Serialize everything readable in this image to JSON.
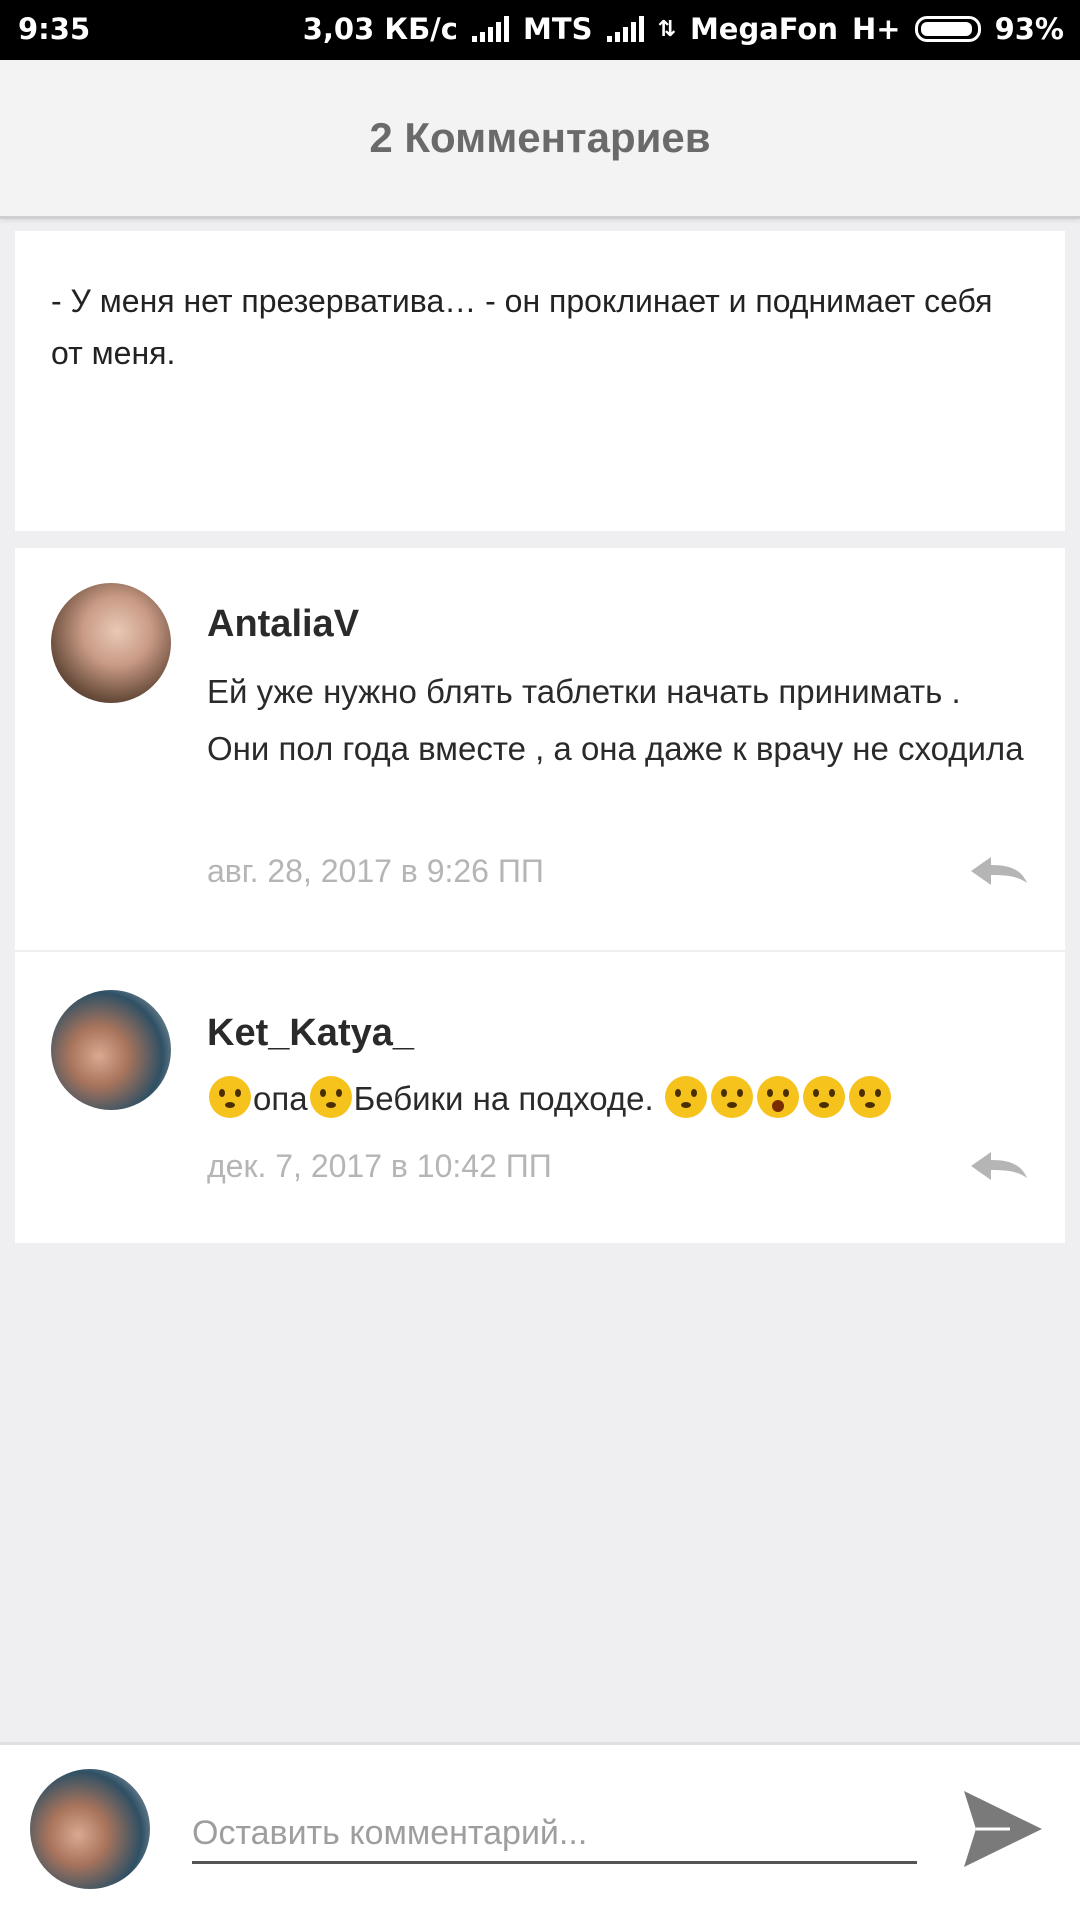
{
  "status_bar": {
    "time": "9:35",
    "speed": "3,03 КБ/с",
    "carrier1": "MTS",
    "carrier2": "MegaFon",
    "network": "H+",
    "battery": "93%"
  },
  "header": {
    "title": "2 Комментариев"
  },
  "excerpt": {
    "text": "- У меня нет презерватива… - он проклинает и поднимает себя от меня."
  },
  "comments": [
    {
      "username": "AntaliaV",
      "text": "Ей уже нужно блять таблетки начать принимать . Они пол года вместе , а она даже к врачу не сходила",
      "timestamp": "авг. 28, 2017 в 9:26 ПП"
    },
    {
      "username": "Ket_Katya_",
      "text_part1": "опа",
      "text_part2": "Бебики на подходе.",
      "timestamp": "дек. 7, 2017 в 10:42 ПП"
    }
  ],
  "composer": {
    "placeholder": "Оставить комментарий..."
  },
  "icons": {
    "reply": "reply-icon",
    "send": "send-icon"
  }
}
